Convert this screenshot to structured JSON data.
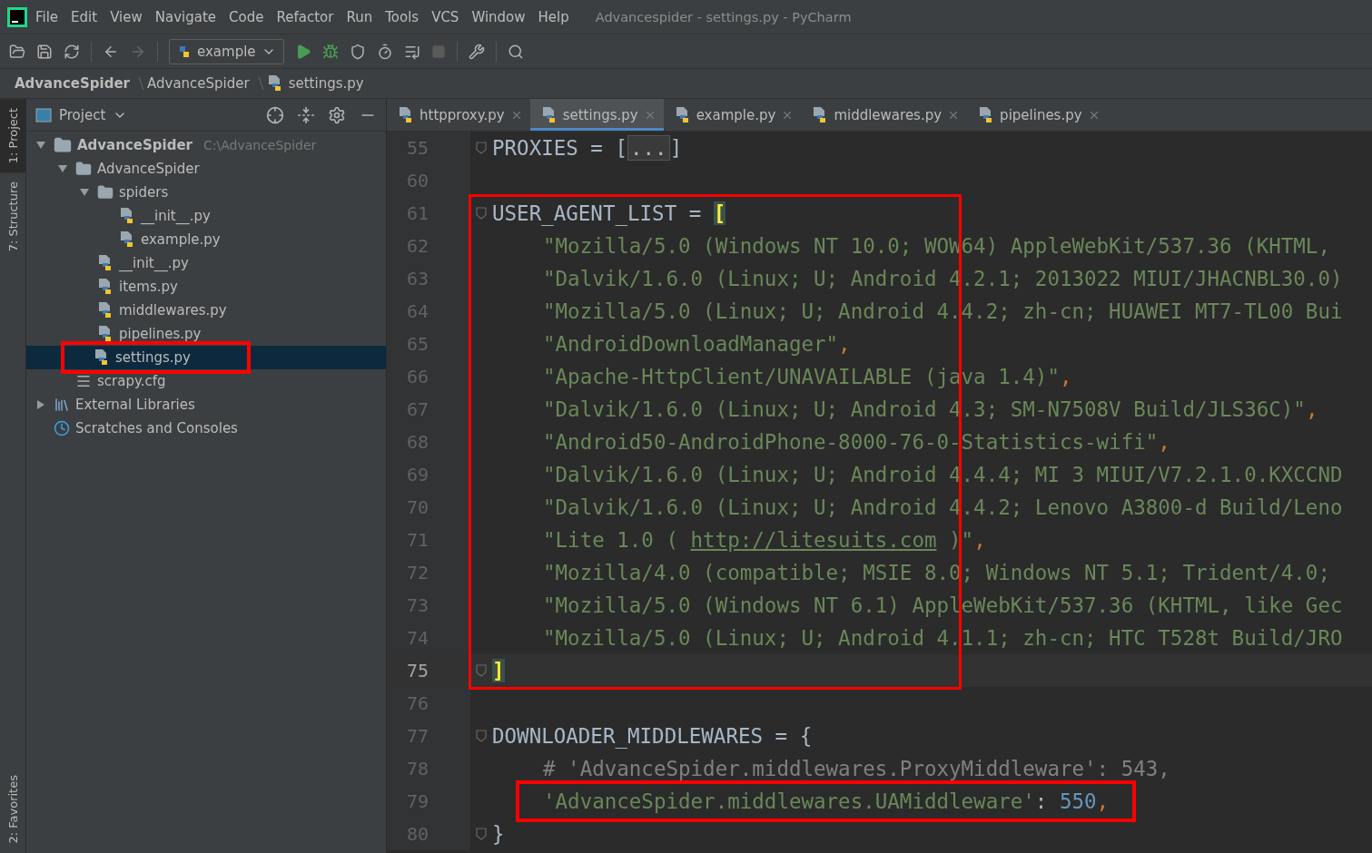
{
  "window": {
    "title": "Advancespider - settings.py - PyCharm"
  },
  "menu": [
    "File",
    "Edit",
    "View",
    "Navigate",
    "Code",
    "Refactor",
    "Run",
    "Tools",
    "VCS",
    "Window",
    "Help"
  ],
  "toolbar": {
    "run_config": "example"
  },
  "breadcrumbs": [
    {
      "label": "AdvanceSpider",
      "bold": true
    },
    {
      "label": "AdvanceSpider",
      "bold": false
    },
    {
      "label": "settings.py",
      "bold": false
    }
  ],
  "tool_stripe": {
    "top": [
      {
        "label": "1: Project",
        "selected": true
      },
      {
        "label": "7: Structure",
        "selected": false
      }
    ],
    "bottom": [
      {
        "label": "2: Favorites",
        "selected": false
      }
    ]
  },
  "project_panel": {
    "title": "Project",
    "tree": [
      {
        "kind": "folder",
        "label": "AdvanceSpider",
        "bold": true,
        "path": "C:\\AdvanceSpider",
        "expanded": true,
        "selected": false,
        "annotated": false,
        "children": [
          {
            "kind": "package",
            "label": "AdvanceSpider",
            "expanded": true,
            "selected": false,
            "annotated": false,
            "children": [
              {
                "kind": "package",
                "label": "spiders",
                "expanded": true,
                "selected": false,
                "annotated": false,
                "children": [
                  {
                    "kind": "python",
                    "label": "__init__.py",
                    "selected": false,
                    "annotated": false
                  },
                  {
                    "kind": "python",
                    "label": "example.py",
                    "selected": false,
                    "annotated": false
                  }
                ]
              },
              {
                "kind": "python",
                "label": "__init__.py",
                "selected": false,
                "annotated": false
              },
              {
                "kind": "python",
                "label": "items.py",
                "selected": false,
                "annotated": false
              },
              {
                "kind": "python",
                "label": "middlewares.py",
                "selected": false,
                "annotated": false
              },
              {
                "kind": "python",
                "label": "pipelines.py",
                "selected": false,
                "annotated": false
              },
              {
                "kind": "python",
                "label": "settings.py",
                "selected": true,
                "annotated": true
              }
            ]
          },
          {
            "kind": "config",
            "label": "scrapy.cfg",
            "selected": false,
            "annotated": false
          }
        ]
      },
      {
        "kind": "library",
        "label": "External Libraries",
        "expanded": false,
        "selected": false,
        "annotated": false
      },
      {
        "kind": "scratches",
        "label": "Scratches and Consoles",
        "selected": false,
        "annotated": false
      }
    ]
  },
  "tabs": [
    {
      "label": "httpproxy.py",
      "selected": false
    },
    {
      "label": "settings.py",
      "selected": true
    },
    {
      "label": "example.py",
      "selected": false
    },
    {
      "label": "middlewares.py",
      "selected": false
    },
    {
      "label": "pipelines.py",
      "selected": false
    }
  ],
  "editor": {
    "lines": [
      {
        "number": "55",
        "fold_marker": true,
        "indented": false,
        "current": false,
        "annotated": false,
        "tokens": [
          {
            "kind": "name",
            "text": "PROXIES = ["
          },
          {
            "kind": "folded",
            "text": "..."
          },
          {
            "kind": "name",
            "text": "]"
          }
        ]
      },
      {
        "number": "60",
        "fold_marker": false,
        "current": false,
        "annotated": false
      },
      {
        "number": "61",
        "fold_marker": true,
        "indented": false,
        "current": false,
        "annotated": true,
        "tokens": [
          {
            "kind": "name",
            "text": "USER_AGENT_LIST = "
          },
          {
            "kind": "match",
            "text": "["
          }
        ]
      },
      {
        "number": "62",
        "fold_marker": false,
        "indented": true,
        "current": false,
        "annotated": true,
        "tokens": [
          {
            "kind": "string",
            "text": "\"Mozilla/5.0 (Windows NT 10.0; WOW64) AppleWebKit/537.36 (KHTML,"
          }
        ]
      },
      {
        "number": "63",
        "fold_marker": false,
        "indented": true,
        "current": false,
        "annotated": true,
        "tokens": [
          {
            "kind": "string",
            "text": "\"Dalvik/1.6.0 (Linux; U; Android 4.2.1; 2013022 MIUI/JHACNBL30.0)"
          }
        ]
      },
      {
        "number": "64",
        "fold_marker": false,
        "indented": true,
        "current": false,
        "annotated": true,
        "tokens": [
          {
            "kind": "string",
            "text": "\"Mozilla/5.0 (Linux; U; Android 4.4.2; zh-cn; HUAWEI MT7-TL00 Bui"
          }
        ]
      },
      {
        "number": "65",
        "fold_marker": false,
        "indented": true,
        "current": false,
        "annotated": true,
        "tokens": [
          {
            "kind": "string",
            "text": "\"AndroidDownloadManager\""
          },
          {
            "kind": "punct",
            "text": ","
          }
        ]
      },
      {
        "number": "66",
        "fold_marker": false,
        "indented": true,
        "current": false,
        "annotated": true,
        "tokens": [
          {
            "kind": "string",
            "text": "\"Apache-HttpClient/UNAVAILABLE (java 1.4)\""
          },
          {
            "kind": "punct",
            "text": ","
          }
        ]
      },
      {
        "number": "67",
        "fold_marker": false,
        "indented": true,
        "current": false,
        "annotated": true,
        "tokens": [
          {
            "kind": "string",
            "text": "\"Dalvik/1.6.0 (Linux; U; Android 4.3; SM-N7508V Build/JLS36C)\""
          },
          {
            "kind": "punct",
            "text": ","
          }
        ]
      },
      {
        "number": "68",
        "fold_marker": false,
        "indented": true,
        "current": false,
        "annotated": true,
        "tokens": [
          {
            "kind": "string",
            "text": "\"Android50-AndroidPhone-8000-76-0-Statistics-wifi\""
          },
          {
            "kind": "punct",
            "text": ","
          }
        ]
      },
      {
        "number": "69",
        "fold_marker": false,
        "indented": true,
        "current": false,
        "annotated": true,
        "tokens": [
          {
            "kind": "string",
            "text": "\"Dalvik/1.6.0 (Linux; U; Android 4.4.4; MI 3 MIUI/V7.2.1.0.KXCCND"
          }
        ]
      },
      {
        "number": "70",
        "fold_marker": false,
        "indented": true,
        "current": false,
        "annotated": true,
        "tokens": [
          {
            "kind": "string",
            "text": "\"Dalvik/1.6.0 (Linux; U; Android 4.4.2; Lenovo A3800-d Build/Leno"
          }
        ]
      },
      {
        "number": "71",
        "fold_marker": false,
        "indented": true,
        "current": false,
        "annotated": true,
        "tokens": [
          {
            "kind": "string",
            "text": "\"Lite 1.0 ( "
          },
          {
            "kind": "link",
            "text": "http://litesuits.com"
          },
          {
            "kind": "string",
            "text": " )\""
          },
          {
            "kind": "punct",
            "text": ","
          }
        ]
      },
      {
        "number": "72",
        "fold_marker": false,
        "indented": true,
        "current": false,
        "annotated": true,
        "tokens": [
          {
            "kind": "string",
            "text": "\"Mozilla/4.0 (compatible; MSIE 8.0; Windows NT 5.1; Trident/4.0;"
          }
        ]
      },
      {
        "number": "73",
        "fold_marker": false,
        "indented": true,
        "current": false,
        "annotated": true,
        "tokens": [
          {
            "kind": "string",
            "text": "\"Mozilla/5.0 (Windows NT 6.1) AppleWebKit/537.36 (KHTML, like Gec"
          }
        ]
      },
      {
        "number": "74",
        "fold_marker": false,
        "indented": true,
        "current": false,
        "annotated": true,
        "tokens": [
          {
            "kind": "string",
            "text": "\"Mozilla/5.0 (Linux; U; Android 4.1.1; zh-cn; HTC T528t Build/JRO"
          }
        ]
      },
      {
        "number": "75",
        "fold_marker": true,
        "indented": false,
        "current": true,
        "annotated": true,
        "tokens": [
          {
            "kind": "match",
            "text": "]"
          }
        ]
      },
      {
        "number": "76",
        "fold_marker": false,
        "current": false,
        "annotated": false
      },
      {
        "number": "77",
        "fold_marker": true,
        "indented": false,
        "current": false,
        "annotated": false,
        "tokens": [
          {
            "kind": "name",
            "text": "DOWNLOADER_MIDDLEWARES = {"
          }
        ]
      },
      {
        "number": "78",
        "fold_marker": false,
        "indented": true,
        "current": false,
        "annotated": false,
        "tokens": [
          {
            "kind": "comment",
            "text": "# 'AdvanceSpider.middlewares.ProxyMiddleware': 543,"
          }
        ]
      },
      {
        "number": "79",
        "fold_marker": false,
        "indented": true,
        "current": false,
        "annotated": true,
        "tokens": [
          {
            "kind": "string",
            "text": "'AdvanceSpider.middlewares.UAMiddleware'"
          },
          {
            "kind": "name",
            "text": ": "
          },
          {
            "kind": "number",
            "text": "550"
          },
          {
            "kind": "punct",
            "text": ","
          }
        ]
      },
      {
        "number": "80",
        "fold_marker": true,
        "indented": false,
        "current": false,
        "annotated": false,
        "tokens": [
          {
            "kind": "name",
            "text": "}"
          }
        ]
      }
    ]
  }
}
